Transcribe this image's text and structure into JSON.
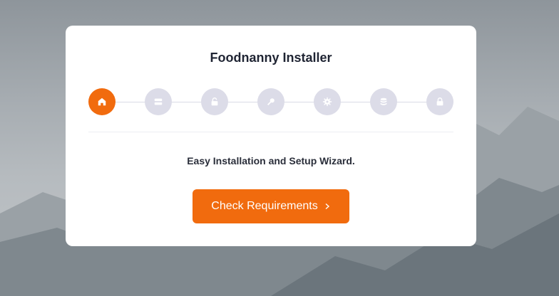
{
  "installer": {
    "title": "Foodnanny Installer",
    "subtitle": "Easy Installation and Setup Wizard.",
    "cta_label": "Check Requirements",
    "cta_icon": "chevron-right-icon",
    "steps": [
      {
        "icon": "home-icon",
        "active": true
      },
      {
        "icon": "server-icon",
        "active": false
      },
      {
        "icon": "unlock-icon",
        "active": false
      },
      {
        "icon": "key-icon",
        "active": false
      },
      {
        "icon": "gear-icon",
        "active": false
      },
      {
        "icon": "database-icon",
        "active": false
      },
      {
        "icon": "lock-icon",
        "active": false
      }
    ]
  },
  "colors": {
    "accent": "#f16b0e",
    "step_inactive": "#dcdce8",
    "card": "#ffffff",
    "text": "#1f2433"
  }
}
